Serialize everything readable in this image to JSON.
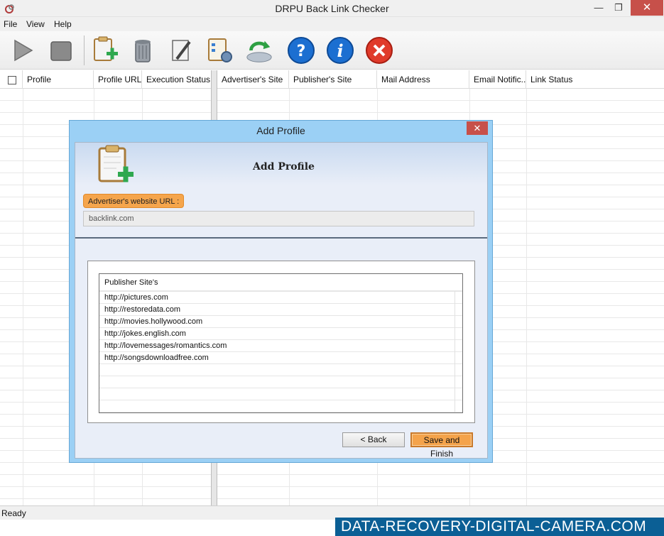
{
  "window": {
    "title": "DRPU Back Link Checker"
  },
  "menu": {
    "items": [
      "File",
      "View",
      "Help"
    ]
  },
  "toolbar": {
    "icons": [
      "play-icon",
      "stop-icon",
      "add-profile-icon",
      "delete-icon",
      "edit-icon",
      "settings-icon",
      "refresh-icon",
      "help-icon",
      "info-icon",
      "exit-icon"
    ]
  },
  "left_grid": {
    "columns": [
      "Profile",
      "Profile URL",
      "Execution Status"
    ]
  },
  "right_grid": {
    "columns": [
      "Advertiser's Site",
      "Publisher's Site",
      "Mail Address",
      "Email Notific...",
      "Link Status"
    ]
  },
  "status": {
    "text": "Ready"
  },
  "watermark": {
    "text": "DATA-RECOVERY-DIGITAL-CAMERA.COM"
  },
  "dialog": {
    "title": "Add Profile",
    "heading": "Add Profile",
    "url_label": "Advertiser's website URL :",
    "url_value": "backlink.com",
    "list_header": "Publisher Site's",
    "sites": [
      "http://pictures.com",
      "http://restoredata.com",
      "http://movies.hollywood.com",
      "http://jokes.english.com",
      "http://lovemessages/romantics.com",
      "http://songsdownloadfree.com"
    ],
    "back_label": "< Back",
    "save_label": "Save and Finish"
  },
  "colors": {
    "accent": "#f5a54c",
    "dialog_frame": "#9bd0f5",
    "close": "#c7504a",
    "watermark_bg": "#0b5f95"
  }
}
